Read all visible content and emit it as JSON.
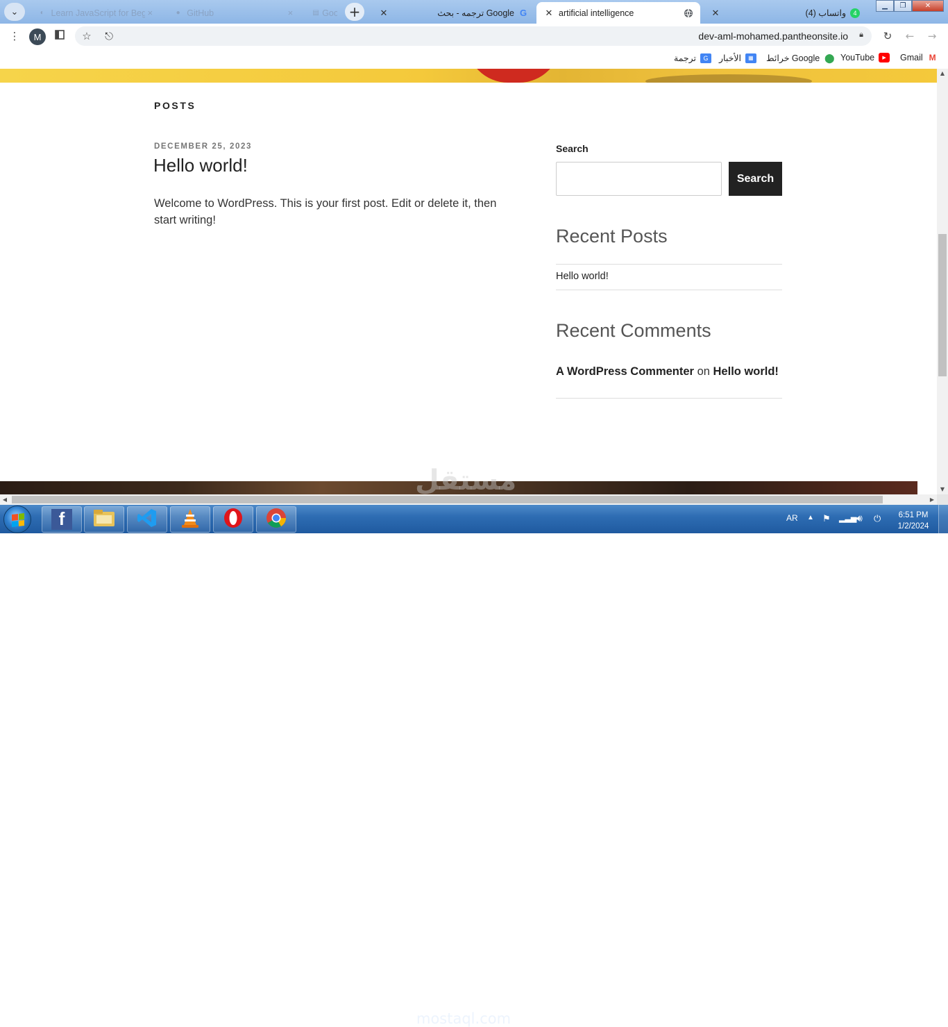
{
  "browser": {
    "tabs": [
      {
        "title": "Learn JavaScript for Beginn",
        "state": "faded",
        "icon": "generic-favicon-icon"
      },
      {
        "title": "GitHub",
        "state": "faded",
        "icon": "github-icon"
      },
      {
        "title": "Google",
        "state": "faded",
        "icon": "google-docs-icon"
      },
      {
        "title": "ترجمه - بحث Google",
        "state": "inactive",
        "icon": "google-g-icon"
      },
      {
        "title": "artificial intelligence",
        "state": "active",
        "icon": "globe-icon"
      },
      {
        "title": "(4) واتساب",
        "state": "inactive",
        "icon": "whatsapp-icon"
      }
    ],
    "new_tab_label": "+",
    "profile_initial": "M",
    "url": "dev-aml-mohamed.pantheonsite.io",
    "bookmarks": [
      {
        "label": "Gmail",
        "icon": "gmail-icon",
        "color": "#ea4335"
      },
      {
        "label": "YouTube",
        "icon": "youtube-icon",
        "color": "#ff0000"
      },
      {
        "label": "خرائط Google",
        "icon": "maps-pin-icon",
        "color": "#34a853"
      },
      {
        "label": "الأخبار",
        "icon": "news-icon",
        "color": "#4285f4"
      },
      {
        "label": "ترجمة",
        "icon": "translate-icon",
        "color": "#4285f4"
      }
    ]
  },
  "page": {
    "posts_heading": "POSTS",
    "post": {
      "date": "DECEMBER 25, 2023",
      "title": "Hello world!",
      "body": "Welcome to WordPress. This is your first post. Edit or delete it, then start writing!"
    },
    "search": {
      "label": "Search",
      "button": "Search",
      "value": ""
    },
    "recent_posts": {
      "title": "Recent Posts",
      "items": [
        "Hello world!"
      ]
    },
    "recent_comments": {
      "title": "Recent Comments",
      "author": "A WordPress Commenter",
      "connector": "on",
      "post": "Hello world!"
    },
    "watermark": "مستقل"
  },
  "taskbar": {
    "apps": [
      "facebook-icon",
      "file-explorer-icon",
      "vscode-icon",
      "vlc-icon",
      "opera-icon",
      "chrome-icon"
    ],
    "language": "AR",
    "time": "6:51 PM",
    "date": "1/2/2024",
    "watermark": "mostaql.com"
  },
  "colors": {
    "accent_dark": "#222222",
    "tabstrip": "#8db6e6",
    "banner_yellow": "#f4c93b",
    "taskbar": "#2e6db3"
  }
}
